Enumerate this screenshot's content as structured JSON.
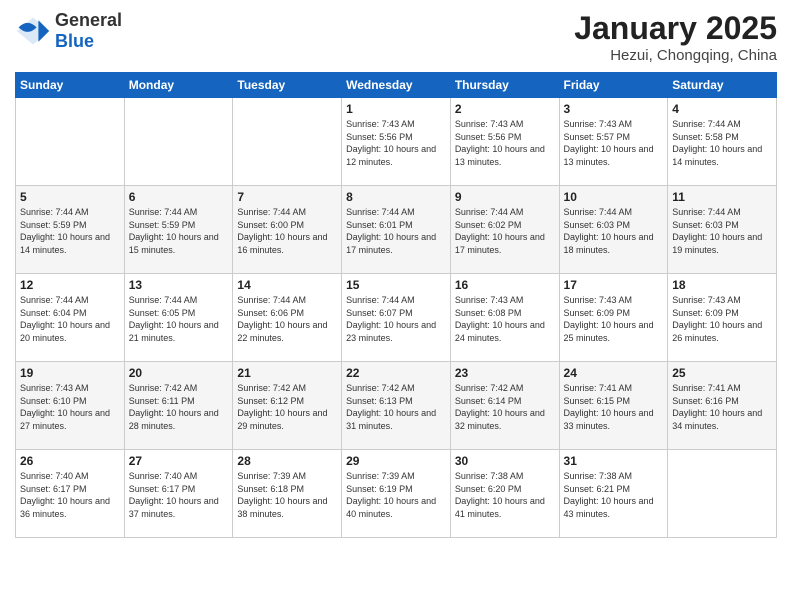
{
  "logo": {
    "general": "General",
    "blue": "Blue"
  },
  "title": "January 2025",
  "location": "Hezui, Chongqing, China",
  "weekdays": [
    "Sunday",
    "Monday",
    "Tuesday",
    "Wednesday",
    "Thursday",
    "Friday",
    "Saturday"
  ],
  "weeks": [
    [
      {
        "day": "",
        "info": ""
      },
      {
        "day": "",
        "info": ""
      },
      {
        "day": "",
        "info": ""
      },
      {
        "day": "1",
        "info": "Sunrise: 7:43 AM\nSunset: 5:56 PM\nDaylight: 10 hours and 12 minutes."
      },
      {
        "day": "2",
        "info": "Sunrise: 7:43 AM\nSunset: 5:56 PM\nDaylight: 10 hours and 13 minutes."
      },
      {
        "day": "3",
        "info": "Sunrise: 7:43 AM\nSunset: 5:57 PM\nDaylight: 10 hours and 13 minutes."
      },
      {
        "day": "4",
        "info": "Sunrise: 7:44 AM\nSunset: 5:58 PM\nDaylight: 10 hours and 14 minutes."
      }
    ],
    [
      {
        "day": "5",
        "info": "Sunrise: 7:44 AM\nSunset: 5:59 PM\nDaylight: 10 hours and 14 minutes."
      },
      {
        "day": "6",
        "info": "Sunrise: 7:44 AM\nSunset: 5:59 PM\nDaylight: 10 hours and 15 minutes."
      },
      {
        "day": "7",
        "info": "Sunrise: 7:44 AM\nSunset: 6:00 PM\nDaylight: 10 hours and 16 minutes."
      },
      {
        "day": "8",
        "info": "Sunrise: 7:44 AM\nSunset: 6:01 PM\nDaylight: 10 hours and 17 minutes."
      },
      {
        "day": "9",
        "info": "Sunrise: 7:44 AM\nSunset: 6:02 PM\nDaylight: 10 hours and 17 minutes."
      },
      {
        "day": "10",
        "info": "Sunrise: 7:44 AM\nSunset: 6:03 PM\nDaylight: 10 hours and 18 minutes."
      },
      {
        "day": "11",
        "info": "Sunrise: 7:44 AM\nSunset: 6:03 PM\nDaylight: 10 hours and 19 minutes."
      }
    ],
    [
      {
        "day": "12",
        "info": "Sunrise: 7:44 AM\nSunset: 6:04 PM\nDaylight: 10 hours and 20 minutes."
      },
      {
        "day": "13",
        "info": "Sunrise: 7:44 AM\nSunset: 6:05 PM\nDaylight: 10 hours and 21 minutes."
      },
      {
        "day": "14",
        "info": "Sunrise: 7:44 AM\nSunset: 6:06 PM\nDaylight: 10 hours and 22 minutes."
      },
      {
        "day": "15",
        "info": "Sunrise: 7:44 AM\nSunset: 6:07 PM\nDaylight: 10 hours and 23 minutes."
      },
      {
        "day": "16",
        "info": "Sunrise: 7:43 AM\nSunset: 6:08 PM\nDaylight: 10 hours and 24 minutes."
      },
      {
        "day": "17",
        "info": "Sunrise: 7:43 AM\nSunset: 6:09 PM\nDaylight: 10 hours and 25 minutes."
      },
      {
        "day": "18",
        "info": "Sunrise: 7:43 AM\nSunset: 6:09 PM\nDaylight: 10 hours and 26 minutes."
      }
    ],
    [
      {
        "day": "19",
        "info": "Sunrise: 7:43 AM\nSunset: 6:10 PM\nDaylight: 10 hours and 27 minutes."
      },
      {
        "day": "20",
        "info": "Sunrise: 7:42 AM\nSunset: 6:11 PM\nDaylight: 10 hours and 28 minutes."
      },
      {
        "day": "21",
        "info": "Sunrise: 7:42 AM\nSunset: 6:12 PM\nDaylight: 10 hours and 29 minutes."
      },
      {
        "day": "22",
        "info": "Sunrise: 7:42 AM\nSunset: 6:13 PM\nDaylight: 10 hours and 31 minutes."
      },
      {
        "day": "23",
        "info": "Sunrise: 7:42 AM\nSunset: 6:14 PM\nDaylight: 10 hours and 32 minutes."
      },
      {
        "day": "24",
        "info": "Sunrise: 7:41 AM\nSunset: 6:15 PM\nDaylight: 10 hours and 33 minutes."
      },
      {
        "day": "25",
        "info": "Sunrise: 7:41 AM\nSunset: 6:16 PM\nDaylight: 10 hours and 34 minutes."
      }
    ],
    [
      {
        "day": "26",
        "info": "Sunrise: 7:40 AM\nSunset: 6:17 PM\nDaylight: 10 hours and 36 minutes."
      },
      {
        "day": "27",
        "info": "Sunrise: 7:40 AM\nSunset: 6:17 PM\nDaylight: 10 hours and 37 minutes."
      },
      {
        "day": "28",
        "info": "Sunrise: 7:39 AM\nSunset: 6:18 PM\nDaylight: 10 hours and 38 minutes."
      },
      {
        "day": "29",
        "info": "Sunrise: 7:39 AM\nSunset: 6:19 PM\nDaylight: 10 hours and 40 minutes."
      },
      {
        "day": "30",
        "info": "Sunrise: 7:38 AM\nSunset: 6:20 PM\nDaylight: 10 hours and 41 minutes."
      },
      {
        "day": "31",
        "info": "Sunrise: 7:38 AM\nSunset: 6:21 PM\nDaylight: 10 hours and 43 minutes."
      },
      {
        "day": "",
        "info": ""
      }
    ]
  ]
}
